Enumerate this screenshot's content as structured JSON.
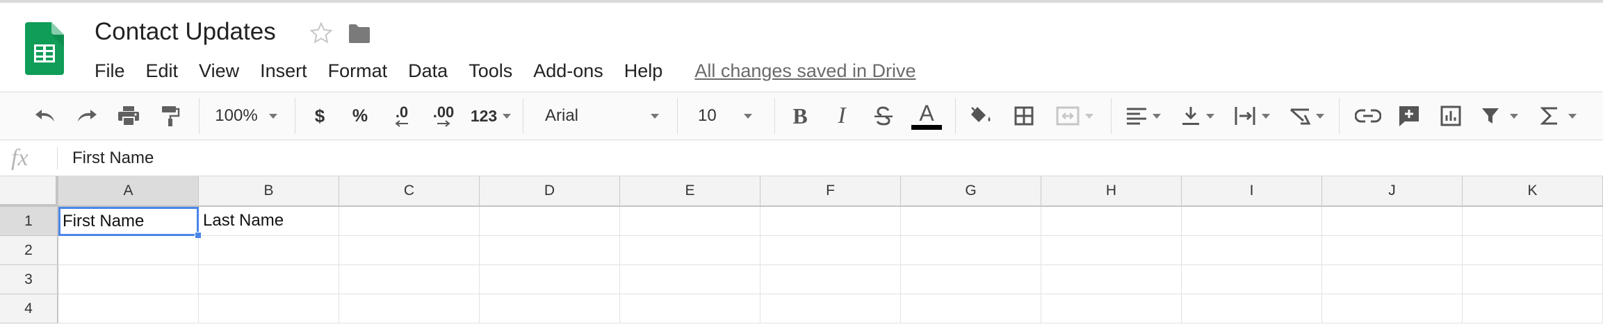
{
  "document": {
    "title": "Contact Updates",
    "save_status": "All changes saved in Drive"
  },
  "menu": [
    "File",
    "Edit",
    "View",
    "Insert",
    "Format",
    "Data",
    "Tools",
    "Add-ons",
    "Help"
  ],
  "toolbar": {
    "zoom": "100%",
    "currency": "$",
    "percent": "%",
    "decrease_decimals": ".0",
    "increase_decimals": ".00",
    "more_formats": "123",
    "font_family": "Arial",
    "font_size": "10",
    "bold": "B",
    "italic": "I",
    "text_color_glyph": "A"
  },
  "formula_bar": {
    "fx_label": "fx",
    "value": "First Name"
  },
  "grid": {
    "columns": [
      "A",
      "B",
      "C",
      "D",
      "E",
      "F",
      "G",
      "H",
      "I",
      "J",
      "K"
    ],
    "rows": [
      "1",
      "2",
      "3",
      "4"
    ],
    "cells": {
      "A1": "First Name",
      "B1": "Last Name"
    },
    "active_cell": "A1"
  },
  "colors": {
    "sheets_green": "#0f9d58",
    "selection_blue": "#4a86e8",
    "header_gray": "#f3f3f3"
  },
  "icons": {
    "undo": "undo-icon",
    "redo": "redo-icon",
    "print": "print-icon",
    "paint_format": "paint-format-icon",
    "strikethrough": "strikethrough-icon",
    "fill_color": "fill-color-icon",
    "borders": "borders-icon",
    "merge": "merge-cells-icon",
    "h_align": "align-left-icon",
    "v_align": "vertical-align-icon",
    "wrap": "text-wrap-icon",
    "rotate": "text-rotate-icon",
    "link": "insert-link-icon",
    "comment": "insert-comment-icon",
    "chart": "insert-chart-icon",
    "filter": "filter-icon",
    "functions": "functions-icon"
  }
}
